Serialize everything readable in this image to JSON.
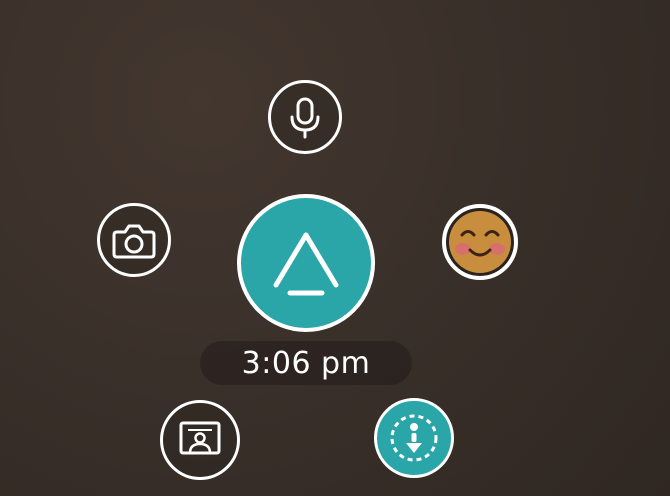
{
  "clock": {
    "time": "3:06 pm"
  },
  "menu": {
    "items": [
      {
        "name": "microphone",
        "icon": "microphone-icon"
      },
      {
        "name": "camera",
        "icon": "camera-icon"
      },
      {
        "name": "home",
        "icon": "home-arrow-icon"
      },
      {
        "name": "emoji",
        "icon": "smiling-face-emoji-icon"
      },
      {
        "name": "share-screen",
        "icon": "screen-share-person-icon"
      },
      {
        "name": "locomotion",
        "icon": "teleport-person-icon"
      }
    ]
  },
  "colors": {
    "background": "#3a302b",
    "accent": "#2aa5a8",
    "ring": "#ffffff"
  }
}
